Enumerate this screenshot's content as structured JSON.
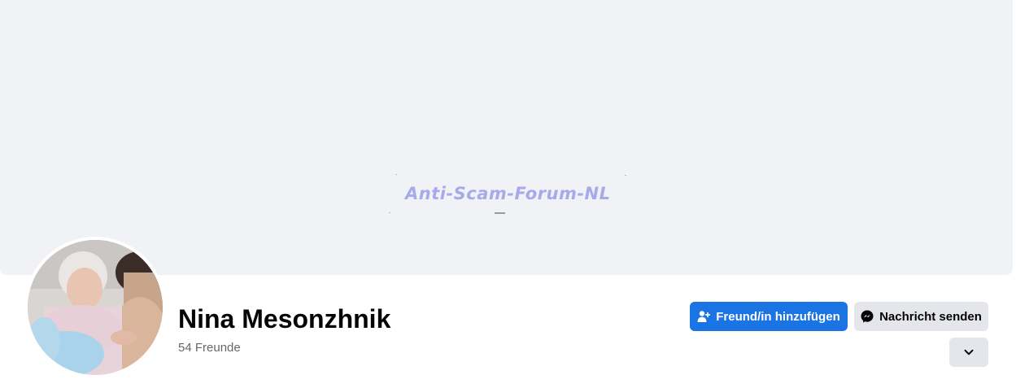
{
  "cover": {
    "watermark_text": "Anti-Scam-Forum-NL",
    "background_color": "#f1f2f6"
  },
  "profile": {
    "name": "Nina Mesonzhnik",
    "friends_count": "54 Freunde"
  },
  "actions": {
    "add_friend_label": "Freund/in hinzufügen",
    "add_friend_icon": "person-add-icon",
    "message_label": "Nachricht senden",
    "message_icon": "messenger-icon",
    "more_icon": "chevron-down-icon"
  },
  "colors": {
    "primary": "#1b74e4",
    "secondary_button": "#e4e6eb",
    "text": "#050505",
    "muted_text": "#65676b"
  }
}
